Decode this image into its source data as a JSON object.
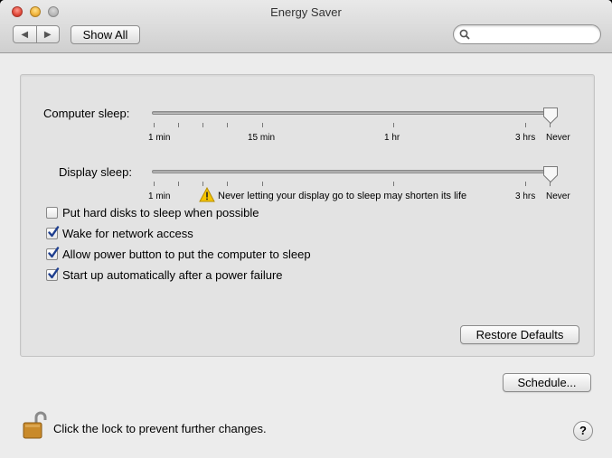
{
  "window": {
    "title": "Energy Saver"
  },
  "toolbar": {
    "back_icon": "◀",
    "forward_icon": "▶",
    "show_all": "Show All",
    "search_placeholder": ""
  },
  "computer_sleep": {
    "label": "Computer sleep:",
    "ticks": [
      "1 min",
      "15 min",
      "1 hr",
      "3 hrs",
      "Never"
    ],
    "value": "Never"
  },
  "display_sleep": {
    "label": "Display sleep:",
    "ticks": [
      "1 min",
      "3 hrs",
      "Never"
    ],
    "value": "Never",
    "warning": "Never letting your display go to sleep may shorten its life"
  },
  "options": [
    {
      "label": "Put hard disks to sleep when possible",
      "checked": false
    },
    {
      "label": "Wake for network access",
      "checked": true
    },
    {
      "label": "Allow power button to put the computer to sleep",
      "checked": true
    },
    {
      "label": "Start up automatically after a power failure",
      "checked": true
    }
  ],
  "buttons": {
    "restore_defaults": "Restore Defaults",
    "schedule": "Schedule..."
  },
  "footer": {
    "lock_text": "Click the lock to prevent further changes.",
    "help": "?"
  },
  "colors": {
    "check": "#1f3f8f",
    "lock_gold": "#c98a2a",
    "warning_yellow": "#f5c400"
  }
}
